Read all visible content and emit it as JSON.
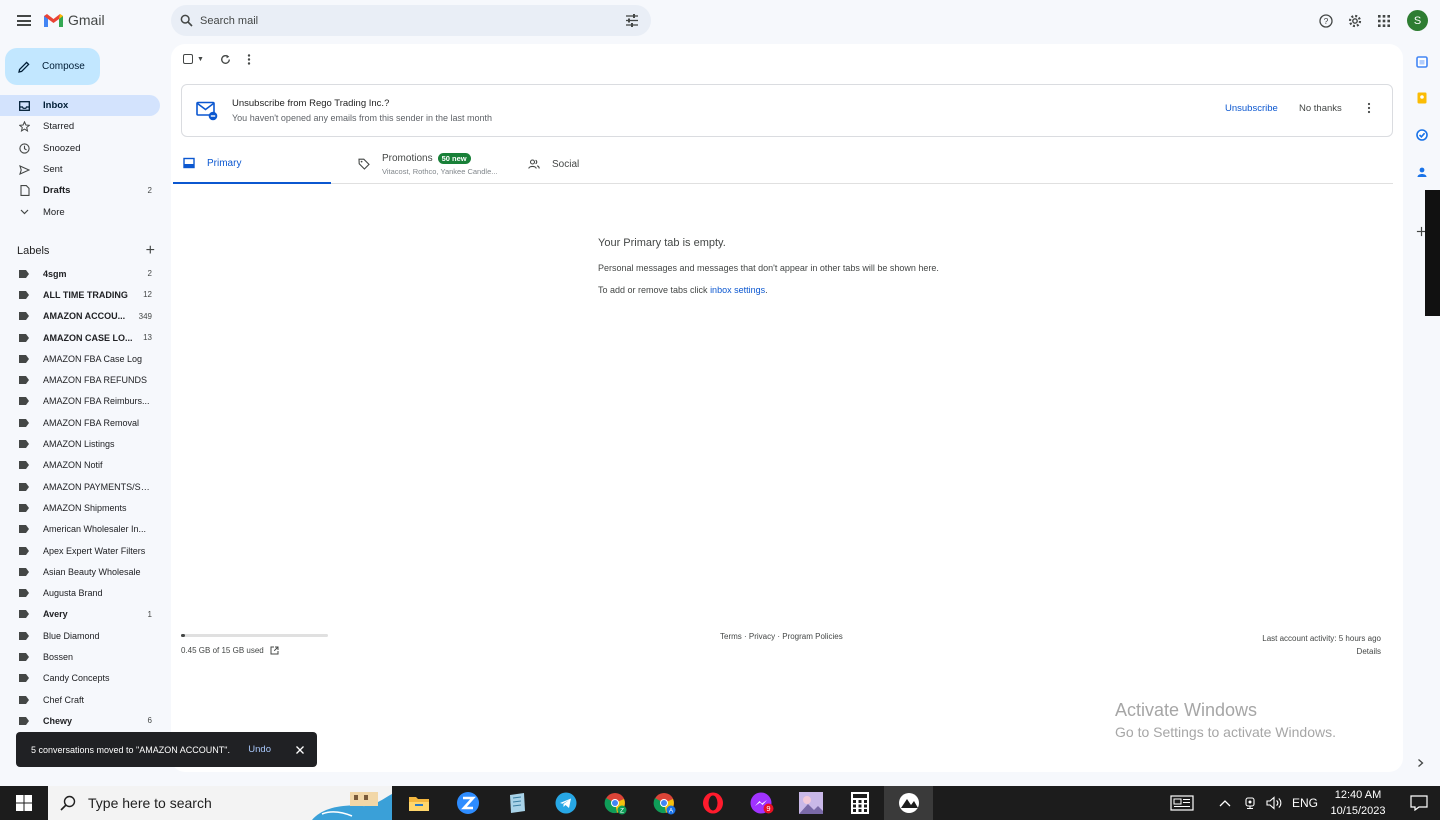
{
  "header": {
    "app_name": "Gmail",
    "search_placeholder": "Search mail",
    "avatar_letter": "S",
    "brand_colors": {
      "red": "#ea4335",
      "blue": "#4285f4",
      "green": "#34a853",
      "yellow": "#fbbc04"
    }
  },
  "compose_label": "Compose",
  "nav": [
    {
      "label": "Inbox",
      "icon": "inbox-icon",
      "count": "",
      "active": true
    },
    {
      "label": "Starred",
      "icon": "star-icon",
      "count": ""
    },
    {
      "label": "Snoozed",
      "icon": "clock-icon",
      "count": ""
    },
    {
      "label": "Sent",
      "icon": "send-icon",
      "count": ""
    },
    {
      "label": "Drafts",
      "icon": "draft-icon",
      "count": "2",
      "bold": true
    },
    {
      "label": "More",
      "icon": "chevron-down-icon",
      "count": ""
    }
  ],
  "labels_title": "Labels",
  "labels": [
    {
      "name": "4sgm",
      "count": "2",
      "bold": true
    },
    {
      "name": "ALL TIME TRADING",
      "count": "12",
      "bold": true
    },
    {
      "name": "AMAZON ACCOU...",
      "count": "349",
      "bold": true
    },
    {
      "name": "AMAZON CASE LO...",
      "count": "13",
      "bold": true
    },
    {
      "name": "AMAZON FBA Case Log",
      "count": ""
    },
    {
      "name": "AMAZON FBA REFUNDS",
      "count": ""
    },
    {
      "name": "AMAZON FBA Reimburs...",
      "count": ""
    },
    {
      "name": "AMAZON FBA Removal",
      "count": ""
    },
    {
      "name": "AMAZON Listings",
      "count": ""
    },
    {
      "name": "AMAZON Notif",
      "count": ""
    },
    {
      "name": "AMAZON PAYMENTS/SE...",
      "count": ""
    },
    {
      "name": "AMAZON Shipments",
      "count": ""
    },
    {
      "name": "American Wholesaler In...",
      "count": ""
    },
    {
      "name": "Apex Expert Water Filters",
      "count": ""
    },
    {
      "name": "Asian Beauty Wholesale",
      "count": ""
    },
    {
      "name": "Augusta Brand",
      "count": ""
    },
    {
      "name": "Avery",
      "count": "1",
      "bold": true
    },
    {
      "name": "Blue Diamond",
      "count": ""
    },
    {
      "name": "Bossen",
      "count": ""
    },
    {
      "name": "Candy Concepts",
      "count": ""
    },
    {
      "name": "Chef Craft",
      "count": ""
    },
    {
      "name": "Chewy",
      "count": "6",
      "bold": true
    }
  ],
  "banner": {
    "title": "Unsubscribe from Rego Trading Inc.?",
    "subtitle": "You haven't opened any emails from this sender in the last month",
    "unsubscribe": "Unsubscribe",
    "no_thanks": "No thanks"
  },
  "tabs": {
    "primary": "Primary",
    "promotions": "Promotions",
    "promotions_badge": "50 new",
    "promotions_sub": "Vitacost, Rothco, Yankee Candle...",
    "social": "Social"
  },
  "empty": {
    "title": "Your Primary tab is empty.",
    "line1": "Personal messages and messages that don't appear in other tabs will be shown here.",
    "line2_prefix": "To add or remove tabs click ",
    "line2_link": "inbox settings",
    "line2_suffix": "."
  },
  "storage": {
    "text": "0.45 GB of 15 GB used",
    "used_fraction": 0.03
  },
  "footer": {
    "terms": "Terms",
    "privacy": "Privacy",
    "policies": "Program Policies",
    "sep": " · "
  },
  "activity": {
    "text": "Last account activity: 5 hours ago",
    "details": "Details"
  },
  "watermark": {
    "line1": "Activate Windows",
    "line2": "Go to Settings to activate Windows."
  },
  "snackbar": {
    "message": "5 conversations moved to \"AMAZON ACCOUNT\".",
    "undo": "Undo"
  },
  "taskbar": {
    "search_placeholder": "Type here to search",
    "language": "ENG",
    "time": "12:40 AM",
    "date": "10/15/2023",
    "badge_count": "9"
  }
}
